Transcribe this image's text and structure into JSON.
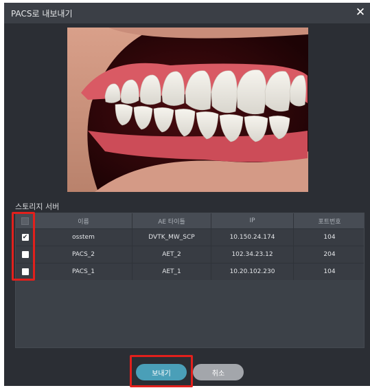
{
  "dialog": {
    "title": "PACS로 내보내기",
    "close_glyph": "✕"
  },
  "preview": {
    "subject": "intraoral photo of teeth (right lateral view)"
  },
  "storage": {
    "section_label": "스토리지 서버",
    "columns": [
      "이름",
      "AE 타이틀",
      "IP",
      "포트번호"
    ],
    "rows": [
      {
        "checked": true,
        "name": "osstem",
        "ae_title": "DVTK_MW_SCP",
        "ip": "10.150.24.174",
        "port": "104"
      },
      {
        "checked": false,
        "name": "PACS_2",
        "ae_title": "AET_2",
        "ip": "102.34.23.12",
        "port": "204"
      },
      {
        "checked": false,
        "name": "PACS_1",
        "ae_title": "AET_1",
        "ip": "10.20.102.230",
        "port": "104"
      }
    ],
    "check_glyph": "✔"
  },
  "buttons": {
    "send": "보내기",
    "cancel": "취소"
  },
  "colors": {
    "dialog_bg": "#2b2e34",
    "titlebar_bg": "#3b3f46",
    "highlight": "#e2201c",
    "send_button": "#4a9fb8",
    "cancel_button": "#a3a6ab"
  }
}
